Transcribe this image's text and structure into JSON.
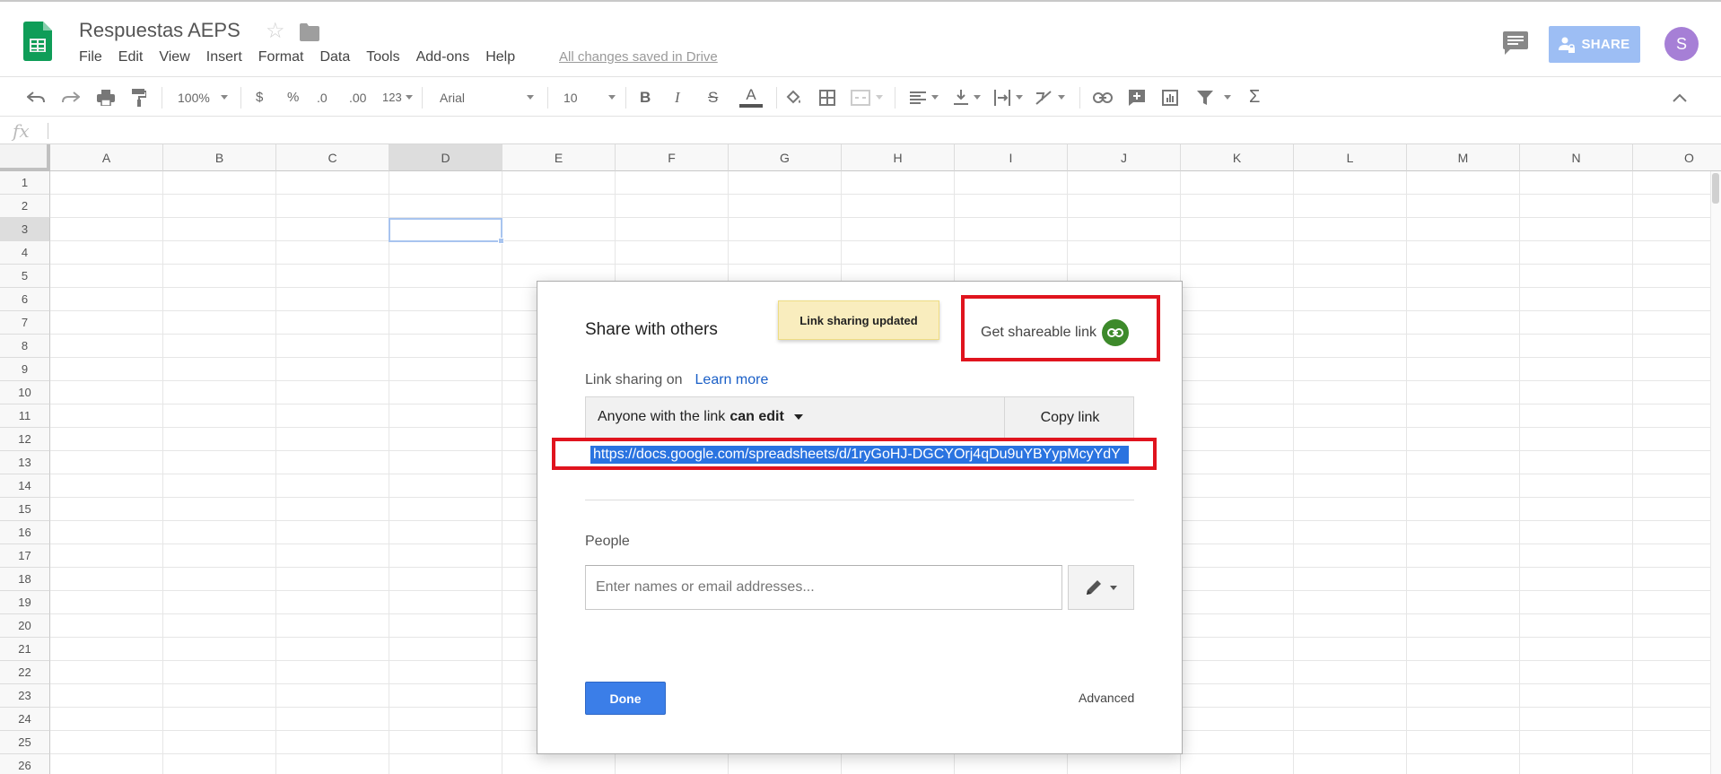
{
  "header": {
    "title": "Respuestas AEPS",
    "menu": [
      "File",
      "Edit",
      "View",
      "Insert",
      "Format",
      "Data",
      "Tools",
      "Add-ons",
      "Help"
    ],
    "saved_status": "All changes saved in Drive",
    "share_label": "SHARE",
    "avatar_letter": "S"
  },
  "toolbar": {
    "zoom": "100%",
    "currency": "$",
    "percent": "%",
    "decrease_decimals": ".0",
    "increase_decimals": ".00",
    "more_formats": "123",
    "font": "Arial",
    "font_size": "10",
    "bold": "B",
    "italic": "I",
    "strikethrough": "S",
    "text_color": "A",
    "functions": "Σ"
  },
  "formula_bar": {
    "fx_label": "fx"
  },
  "grid": {
    "columns": [
      "A",
      "B",
      "C",
      "D",
      "E",
      "F",
      "G",
      "H",
      "I",
      "J",
      "K",
      "L",
      "M",
      "N",
      "O"
    ],
    "rows": [
      "1",
      "2",
      "3",
      "4",
      "5",
      "6",
      "7",
      "8",
      "9",
      "10",
      "11",
      "12",
      "13",
      "14",
      "15",
      "16",
      "17",
      "18",
      "19",
      "20",
      "21",
      "22",
      "23",
      "24",
      "25",
      "26"
    ],
    "selected_column": "D",
    "selected_row": "3"
  },
  "dialog": {
    "title": "Share with others",
    "toast": "Link sharing updated",
    "get_link": "Get shareable link",
    "link_sharing_label": "Link sharing on",
    "learn_more": "Learn more",
    "permission_prefix": "Anyone with the link",
    "permission_level": "can edit",
    "copy_link": "Copy link",
    "url": "https://docs.google.com/spreadsheets/d/1ryGoHJ-DGCYOrj4qDu9uYBYypMcyYdY",
    "people_label": "People",
    "people_placeholder": "Enter names or email addresses...",
    "done": "Done",
    "advanced": "Advanced"
  },
  "colors": {
    "share_button": "#9dbef4",
    "highlight_box": "#e0141e",
    "done_button": "#3b7ee8",
    "link_icon": "#3d8a2b",
    "toast_bg": "#f9edbe"
  }
}
